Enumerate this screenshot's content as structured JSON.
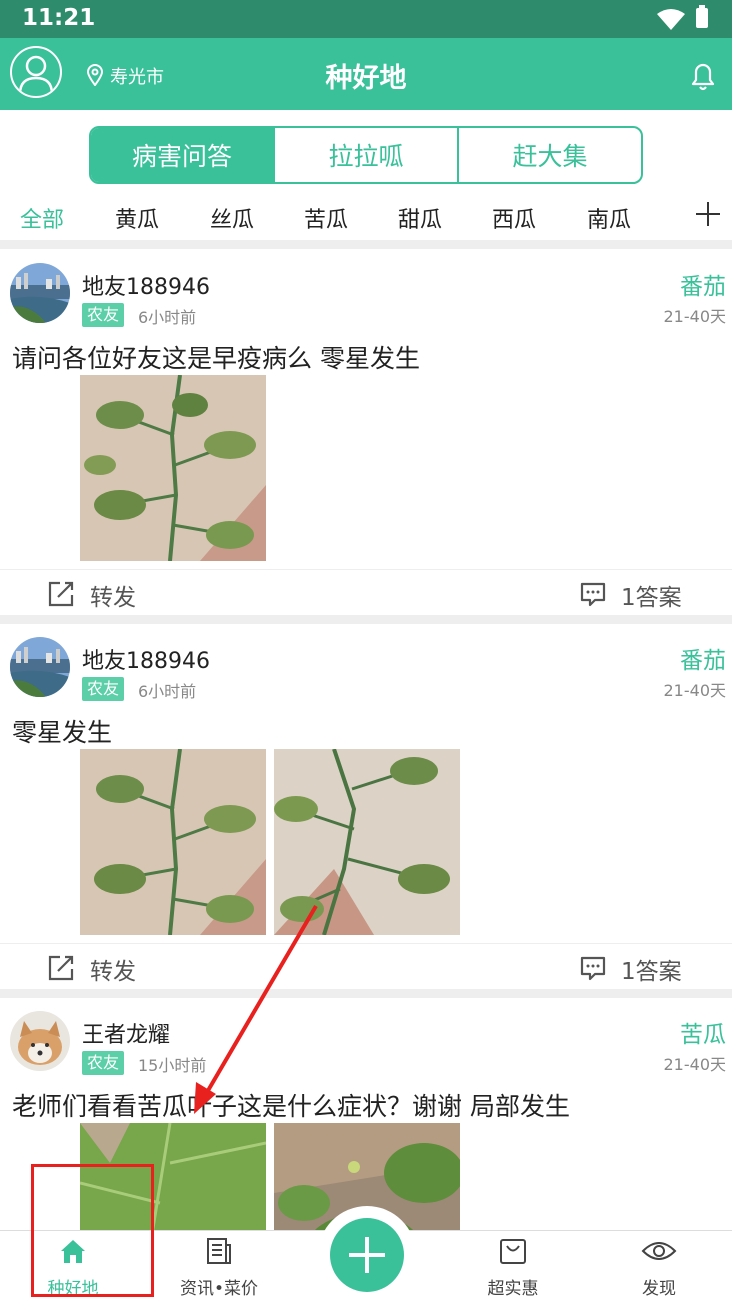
{
  "status_bar": {
    "time": "11:21"
  },
  "app_bar": {
    "location": "寿光市",
    "title": "种好地"
  },
  "segments": [
    "病害问答",
    "拉拉呱",
    "赶大集"
  ],
  "categories": [
    "全部",
    "黄瓜",
    "丝瓜",
    "苦瓜",
    "甜瓜",
    "西瓜",
    "南瓜"
  ],
  "posts": [
    {
      "user": "地友188946",
      "badge": "农友",
      "time": "6小时前",
      "crop": "番茄",
      "age": "21-40天",
      "text": "请问各位好友这是早疫病么 零星发生",
      "forward": "转发",
      "answers": "1答案"
    },
    {
      "user": "地友188946",
      "badge": "农友",
      "time": "6小时前",
      "crop": "番茄",
      "age": "21-40天",
      "text": "零星发生",
      "forward": "转发",
      "answers": "1答案"
    },
    {
      "user": "王者龙耀",
      "badge": "农友",
      "time": "15小时前",
      "crop": "苦瓜",
      "age": "21-40天",
      "text": "老师们看看苦瓜叶子这是什么症状？谢谢 局部发生"
    }
  ],
  "bottom_nav": [
    {
      "label": "种好地",
      "icon": "home-icon",
      "active": true
    },
    {
      "label": "资讯•菜价",
      "icon": "news-icon"
    },
    {
      "label": "超实惠",
      "icon": "shopping-bag-icon"
    },
    {
      "label": "发现",
      "icon": "eye-icon"
    }
  ],
  "colors": {
    "primary": "#3ac19a",
    "status_bar": "#2e8c6c",
    "annotation": "#e8201e"
  }
}
